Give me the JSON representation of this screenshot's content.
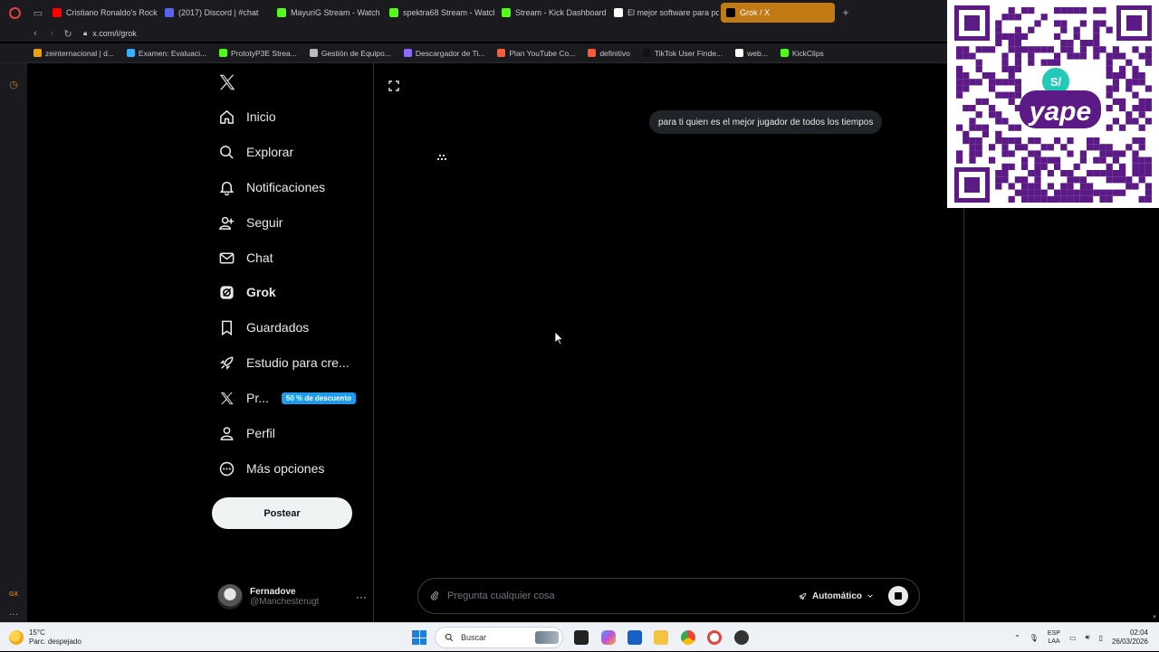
{
  "browser": {
    "tabs": [
      {
        "label": "Cristiano Ronaldo's Rocke",
        "favicon_color": "#ff0000"
      },
      {
        "label": "(2017) Discord | #chat",
        "favicon_color": "#5865f2"
      },
      {
        "label": "MayuriG Stream - Watch L",
        "favicon_color": "#53fc18"
      },
      {
        "label": "spektra68 Stream - Watch",
        "favicon_color": "#53fc18"
      },
      {
        "label": "Stream - Kick Dashboard",
        "favicon_color": "#53fc18"
      },
      {
        "label": "El mejor software para po",
        "favicon_color": "#ffffff"
      },
      {
        "label": "Grok / X",
        "favicon_color": "#000000",
        "active": true
      }
    ],
    "url": "x.com/i/grok",
    "bookmarks": [
      {
        "label": "zeinternacional | d...",
        "color": "#f2a000"
      },
      {
        "label": "Examen: Evaluaci...",
        "color": "#3ab0ff"
      },
      {
        "label": "PrototyP3E Strea...",
        "color": "#53fc18"
      },
      {
        "label": "Gestión de Equipo...",
        "color": "#bbbbbb"
      },
      {
        "label": "Descargador de Ti...",
        "color": "#8e6bff"
      },
      {
        "label": "Plan YouTube Co...",
        "color": "#ff5a36"
      },
      {
        "label": "definitivo",
        "color": "#ff5a36"
      },
      {
        "label": "TikTok User Finde...",
        "color": "#111111"
      },
      {
        "label": "web...",
        "color": "#ffffff"
      },
      {
        "label": "KickClips",
        "color": "#53fc18"
      }
    ]
  },
  "nav": {
    "items": [
      {
        "label": "Inicio",
        "icon": "home-icon"
      },
      {
        "label": "Explorar",
        "icon": "search-icon"
      },
      {
        "label": "Notificaciones",
        "icon": "bell-icon"
      },
      {
        "label": "Seguir",
        "icon": "follow-icon"
      },
      {
        "label": "Chat",
        "icon": "mail-icon"
      },
      {
        "label": "Grok",
        "icon": "grok-icon",
        "active": true
      },
      {
        "label": "Guardados",
        "icon": "bookmark-icon"
      },
      {
        "label": "Estudio para cre...",
        "icon": "rocket-icon"
      },
      {
        "label": "Pr...",
        "icon": "x-icon",
        "badge": "50 % de descuento"
      },
      {
        "label": "Perfil",
        "icon": "person-icon"
      },
      {
        "label": "Más opciones",
        "icon": "more-circle-icon"
      }
    ],
    "post_label": "Postear"
  },
  "user": {
    "name": "Fernadove",
    "handle": "@Manchesterugt"
  },
  "chat": {
    "user_message": "para ti quien es el mejor jugador de todos los tiempos",
    "input_placeholder": "Pregunta cualquier cosa",
    "mode_label": "Automático"
  },
  "overlay": {
    "qr_brand": "yape",
    "qr_badge": "S/"
  },
  "taskbar": {
    "weather_temp": "15°C",
    "weather_desc": "Parc. despejado",
    "search_placeholder": "Buscar",
    "lang_top": "ESP",
    "lang_bottom": "LAA",
    "time": "02:04",
    "date": "26/03/2026"
  },
  "colors": {
    "accent_tab": "#c27a14",
    "promo_badge": "#1d9bf0",
    "qr_purple": "#5b1a86"
  }
}
